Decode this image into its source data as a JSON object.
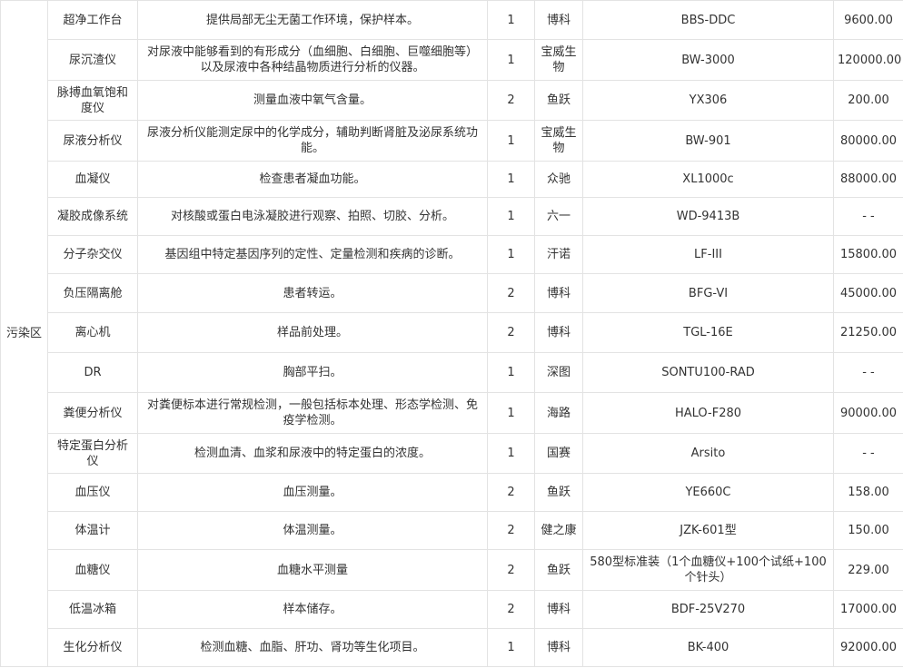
{
  "zone": "污染区",
  "rows": [
    {
      "name": "超净工作台",
      "description": "提供局部无尘无菌工作环境，保护样本。",
      "quantity": "1",
      "brand": "博科",
      "model": "BBS-DDC",
      "price": "9600.00"
    },
    {
      "name": "尿沉渣仪",
      "description": "对尿液中能够看到的有形成分（血细胞、白细胞、巨噬细胞等）以及尿液中各种结晶物质进行分析的仪器。",
      "quantity": "1",
      "brand": "宝威生物",
      "model": "BW-3000",
      "price": "120000.00"
    },
    {
      "name": "脉搏血氧饱和度仪",
      "description": "测量血液中氧气含量。",
      "quantity": "2",
      "brand": "鱼跃",
      "model": "YX306",
      "price": "200.00"
    },
    {
      "name": "尿液分析仪",
      "description": "尿液分析仪能测定尿中的化学成分，辅助判断肾脏及泌尿系统功能。",
      "quantity": "1",
      "brand": "宝威生物",
      "model": "BW-901",
      "price": "80000.00"
    },
    {
      "name": "血凝仪",
      "description": "检查患者凝血功能。",
      "quantity": "1",
      "brand": "众驰",
      "model": "XL1000c",
      "price": "88000.00"
    },
    {
      "name": "凝胶成像系统",
      "description": "对核酸或蛋白电泳凝胶进行观察、拍照、切胶、分析。",
      "quantity": "1",
      "brand": "六一",
      "model": "WD-9413B",
      "price": "- -"
    },
    {
      "name": "分子杂交仪",
      "description": "基因组中特定基因序列的定性、定量检测和疾病的诊断。",
      "quantity": "1",
      "brand": "汗诺",
      "model": "LF-III",
      "price": "15800.00"
    },
    {
      "name": "负压隔离舱",
      "description": "患者转运。",
      "quantity": "2",
      "brand": "博科",
      "model": "BFG-VI",
      "price": "45000.00"
    },
    {
      "name": "离心机",
      "description": "样品前处理。",
      "quantity": "2",
      "brand": "博科",
      "model": "TGL-16E",
      "price": "21250.00"
    },
    {
      "name": "DR",
      "description": "胸部平扫。",
      "quantity": "1",
      "brand": "深图",
      "model": "SONTU100-RAD",
      "price": "- -"
    },
    {
      "name": "粪便分析仪",
      "description": "对粪便标本进行常规检测，一般包括标本处理、形态学检测、免疫学检测。",
      "quantity": "1",
      "brand": "海路",
      "model": "HALO-F280",
      "price": "90000.00"
    },
    {
      "name": "特定蛋白分析仪",
      "description": "检测血清、血浆和尿液中的特定蛋白的浓度。",
      "quantity": "1",
      "brand": "国赛",
      "model": "Arsito",
      "price": "- -"
    },
    {
      "name": "血压仪",
      "description": "血压测量。",
      "quantity": "2",
      "brand": "鱼跃",
      "model": "YE660C",
      "price": "158.00"
    },
    {
      "name": "体温计",
      "description": "体温测量。",
      "quantity": "2",
      "brand": "健之康",
      "model": "JZK-601型",
      "price": "150.00"
    },
    {
      "name": "血糖仪",
      "description": "血糖水平测量",
      "quantity": "2",
      "brand": "鱼跃",
      "model": "580型标准装（1个血糖仪+100个试纸+100个针头）",
      "price": "229.00"
    },
    {
      "name": "低温冰箱",
      "description": "样本储存。",
      "quantity": "2",
      "brand": "博科",
      "model": "BDF-25V270",
      "price": "17000.00"
    },
    {
      "name": "生化分析仪",
      "description": "检测血糖、血脂、肝功、肾功等生化项目。",
      "quantity": "1",
      "brand": "博科",
      "model": "BK-400",
      "price": "92000.00"
    }
  ]
}
